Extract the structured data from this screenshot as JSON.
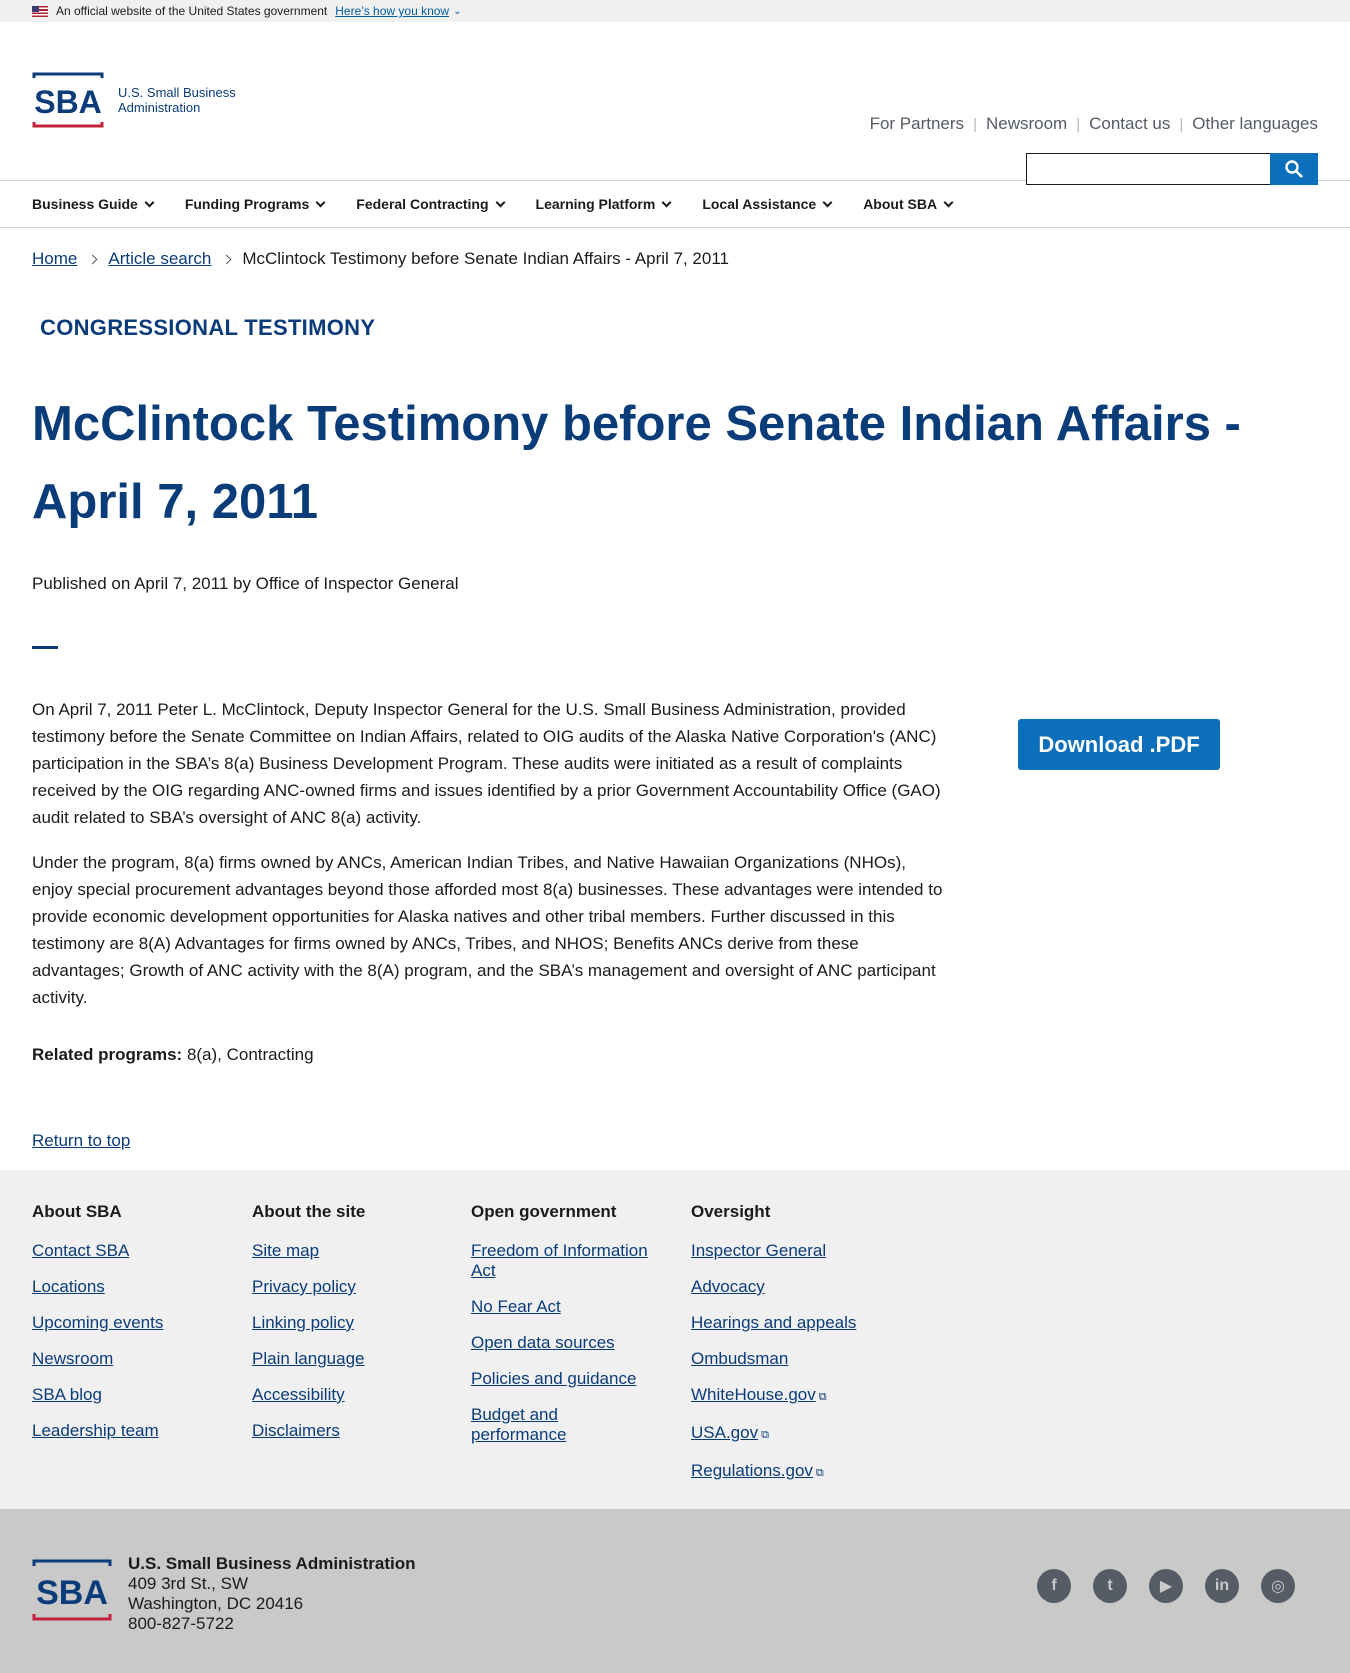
{
  "gov_banner": {
    "text": "An official website of the United States government",
    "link": "Here’s how you know"
  },
  "logo": {
    "mark": "SBA",
    "line1": "U.S. Small Business",
    "line2": "Administration"
  },
  "utility_nav": [
    "For Partners",
    "Newsroom",
    "Contact us",
    "Other languages"
  ],
  "search": {
    "placeholder": "",
    "icon": "search-icon"
  },
  "main_nav": [
    "Business Guide",
    "Funding Programs",
    "Federal Contracting",
    "Learning Platform",
    "Local Assistance",
    "About SBA"
  ],
  "breadcrumb": {
    "home": "Home",
    "article_search": "Article search",
    "current": "McClintock Testimony before Senate Indian Affairs - April 7, 2011"
  },
  "article": {
    "eyebrow": "CONGRESSIONAL TESTIMONY",
    "title": "McClintock Testimony before Senate Indian Affairs - April 7, 2011",
    "published": "Published on April 7, 2011 by Office of Inspector General",
    "paragraphs": [
      "On April 7, 2011 Peter L. McClintock, Deputy Inspector General for the U.S. Small Business Administration, provided testimony before the Senate Committee on Indian Affairs, related to OIG audits of the Alaska Native Corporation's (ANC) participation in the SBA’s 8(a) Business Development Program. These audits were initiated as a result of complaints received by the OIG regarding ANC-owned firms and issues identified by a prior Government Accountability Office (GAO) audit related to SBA’s oversight of ANC 8(a) activity.",
      "Under the program, 8(a) firms owned by ANCs, American Indian Tribes, and Native Hawaiian Organizations (NHOs), enjoy special procurement advantages beyond those afforded most 8(a) businesses. These advantages were intended to provide economic development opportunities for Alaska natives and other tribal members.   Further discussed in this testimony are 8(A) Advantages for firms owned by ANCs, Tribes, and NHOS; Benefits ANCs derive from these advantages; Growth of ANC activity with the 8(A) program, and the SBA’s management and oversight of ANC participant activity."
    ],
    "related_label": "Related programs:",
    "related_value": "8(a), Contracting",
    "download_label": "Download .PDF",
    "return_top": "Return to top"
  },
  "footer": {
    "columns": [
      {
        "heading": "About SBA",
        "links": [
          "Contact SBA",
          "Locations",
          "Upcoming events",
          "Newsroom",
          "SBA blog",
          "Leadership team"
        ]
      },
      {
        "heading": "About the site",
        "links": [
          "Site map",
          "Privacy policy",
          "Linking policy",
          "Plain language",
          "Accessibility",
          "Disclaimers"
        ]
      },
      {
        "heading": "Open government",
        "links": [
          "Freedom of Information Act",
          "No Fear Act",
          "Open data sources",
          "Policies and guidance",
          "Budget and performance"
        ]
      },
      {
        "heading": "Oversight",
        "links": [
          "Inspector General",
          "Advocacy",
          "Hearings and appeals",
          "Ombudsman",
          "WhiteHouse.gov",
          "USA.gov",
          "Regulations.gov"
        ]
      }
    ],
    "org": "U.S. Small Business Administration",
    "address1": "409 3rd St., SW",
    "address2": "Washington, DC 20416",
    "phone": "800-827-5722",
    "social": [
      "facebook-icon",
      "twitter-icon",
      "youtube-icon",
      "linkedin-icon",
      "instagram-icon"
    ]
  },
  "colors": {
    "navy": "#0b3c7a",
    "blue": "#0b6fbb",
    "red": "#c5203a"
  }
}
